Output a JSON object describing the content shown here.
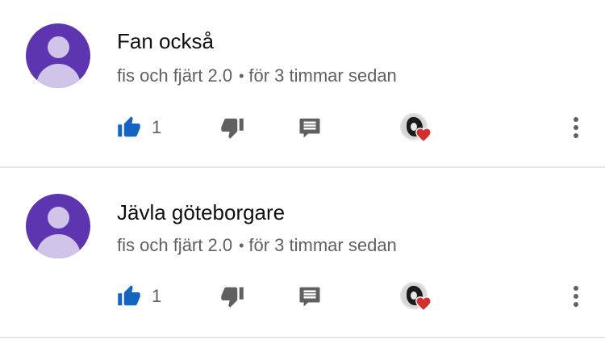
{
  "comments": [
    {
      "text": "Fan också",
      "author": "fis och fjärt 2.0",
      "separator": "•",
      "time": "för 3 timmar sedan",
      "like_count": "1"
    },
    {
      "text": "Jävla göteborgare",
      "author": "fis och fjärt 2.0",
      "separator": "•",
      "time": "för 3 timmar sedan",
      "like_count": "1"
    }
  ],
  "icons": {
    "like": "thumbs-up-icon",
    "dislike": "thumbs-down-icon",
    "reply": "reply-icon",
    "creator_heart": "heart-icon",
    "more": "more-vert-icon"
  },
  "colors": {
    "avatar_bg": "#5e35b1",
    "avatar_fg": "#d1c4e9",
    "like_active": "#1565c0",
    "icon_gray": "#606060",
    "heart": "#d32f2f",
    "divider": "#e5e5e5"
  }
}
